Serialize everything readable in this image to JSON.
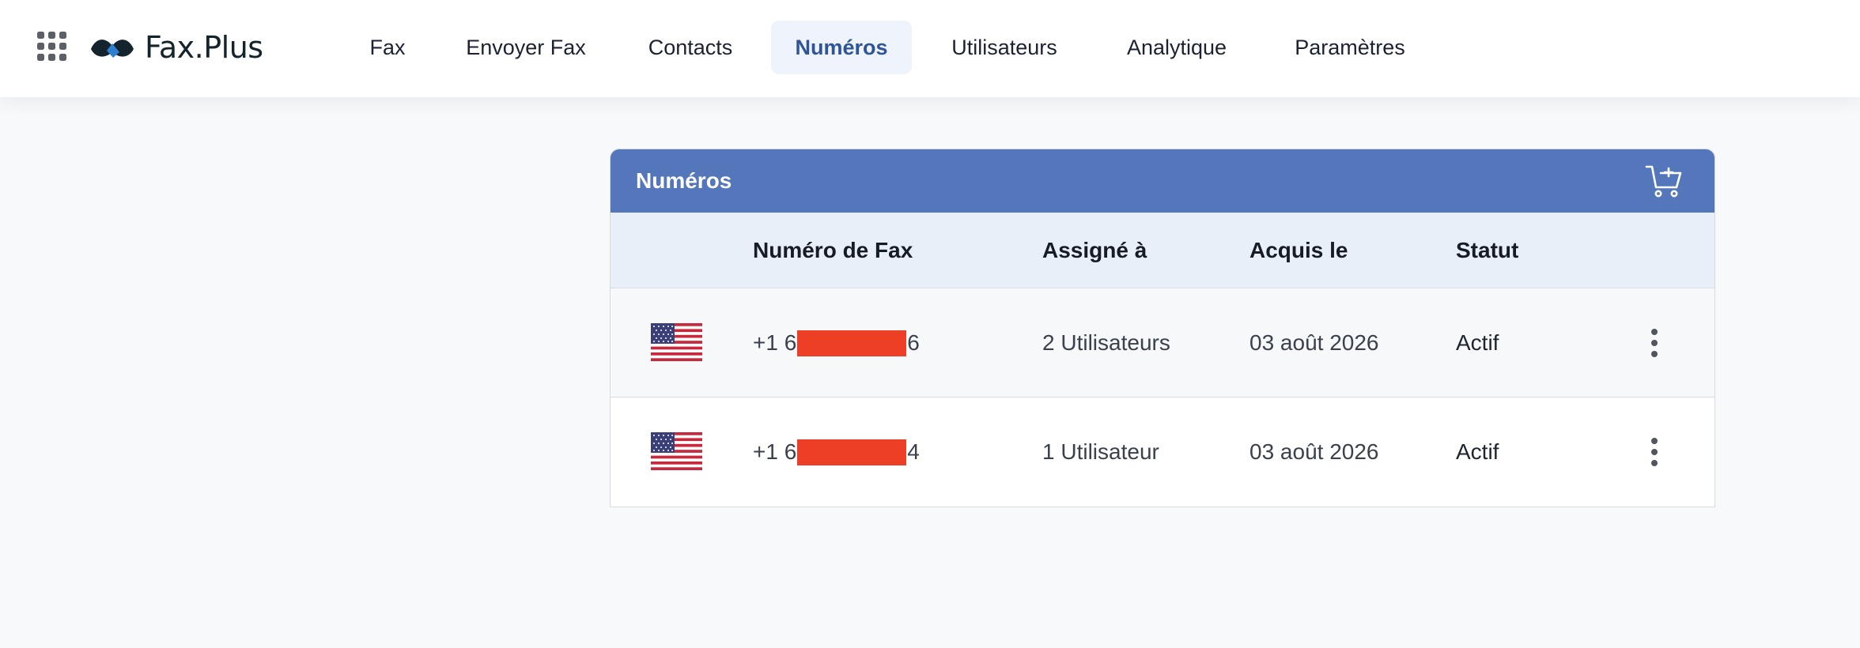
{
  "brand": {
    "name": "Fax.Plus"
  },
  "nav": {
    "items": [
      {
        "label": "Fax",
        "active": false
      },
      {
        "label": "Envoyer Fax",
        "active": false
      },
      {
        "label": "Contacts",
        "active": false
      },
      {
        "label": "Numéros",
        "active": true
      },
      {
        "label": "Utilisateurs",
        "active": false
      },
      {
        "label": "Analytique",
        "active": false
      },
      {
        "label": "Paramètres",
        "active": false
      }
    ]
  },
  "panel": {
    "title": "Numéros",
    "header_icon": "cart-add-icon",
    "columns": [
      "Numéro de Fax",
      "Assigné à",
      "Acquis le",
      "Statut"
    ],
    "rows": [
      {
        "flag": "us-flag-icon",
        "fax_prefix": "+1 6",
        "fax_suffix": "6",
        "assigned": "2 Utilisateurs",
        "acquired": "03 août 2026",
        "status": "Actif"
      },
      {
        "flag": "us-flag-icon",
        "fax_prefix": "+1 6",
        "fax_suffix": "4",
        "assigned": "1 Utilisateur",
        "acquired": "03 août 2026",
        "status": "Actif"
      }
    ]
  },
  "colors": {
    "header_blue": "#5477bb",
    "active_nav_text": "#2f5599",
    "active_nav_bg": "#eff4fc",
    "redaction": "#ec3f25"
  }
}
